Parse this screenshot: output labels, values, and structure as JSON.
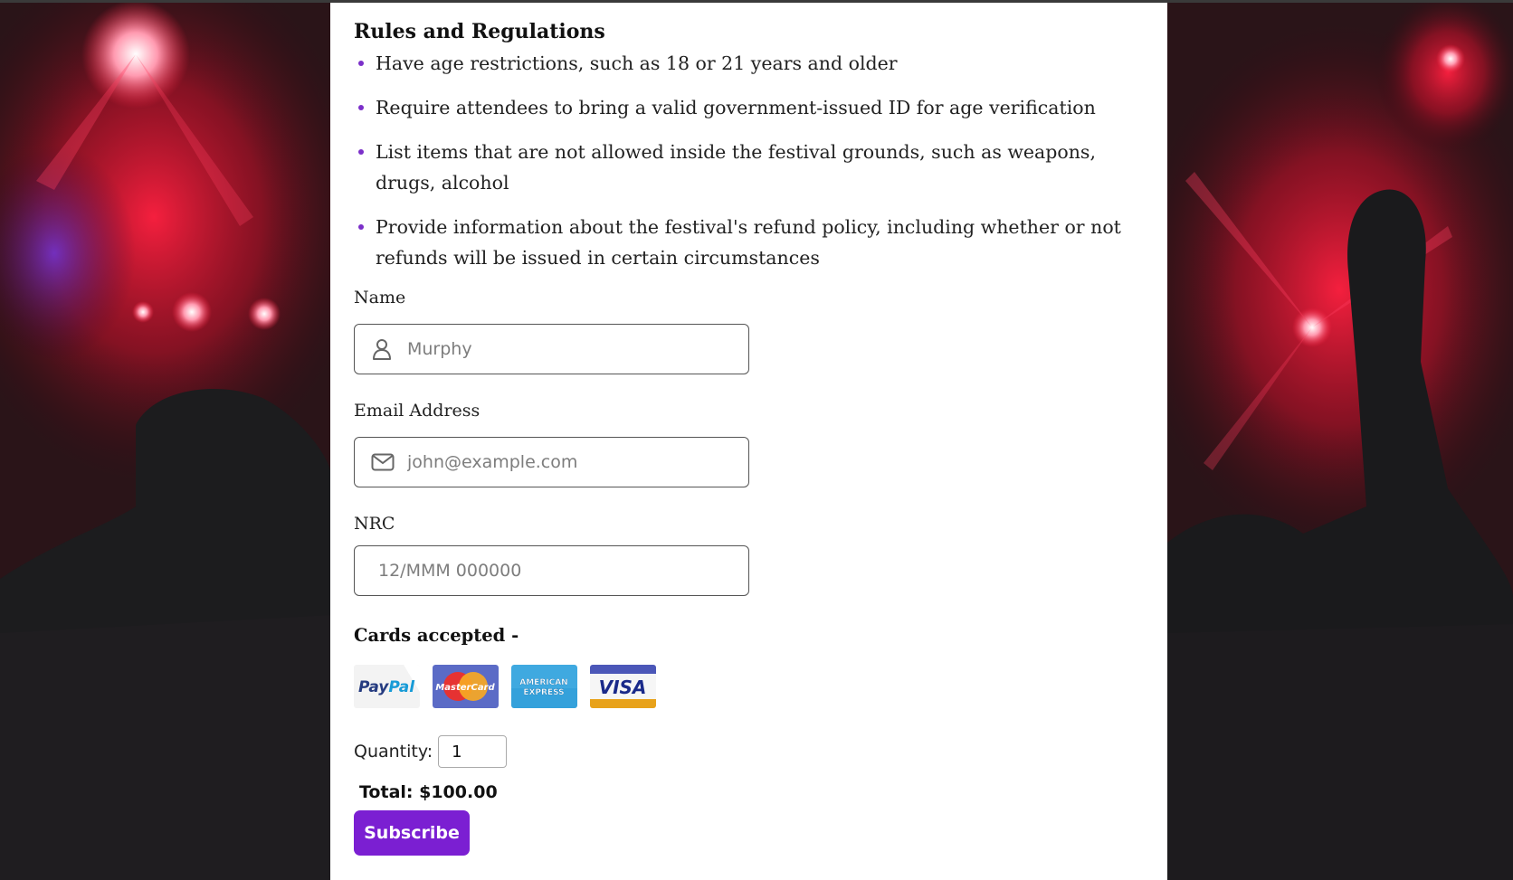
{
  "page": {
    "rules_title": "Rules and Regulations",
    "rules": [
      "Have age restrictions, such as 18 or 21 years and older",
      "Require attendees to bring a valid government-issued ID for age verification",
      "List items that are not allowed inside the festival grounds, such as weapons, drugs, alcohol",
      "Provide information about the festival's refund policy, including whether or not refunds will be issued in certain circumstances"
    ]
  },
  "form": {
    "name_label": "Name",
    "name_placeholder": "Murphy",
    "email_label": "Email Address",
    "email_placeholder": "john@example.com",
    "nrc_label": "NRC",
    "nrc_placeholder": "12/MMM 000000",
    "cards_title": "Cards accepted -",
    "cards": [
      "PayPal",
      "MasterCard",
      "AMERICAN EXPRESS",
      "VISA"
    ],
    "quantity_label": "Quantity:",
    "quantity_value": "1",
    "total": "Total: $100.00",
    "subscribe_label": "Subscribe"
  },
  "colors": {
    "accent": "#7b1fd2",
    "bullet": "#7b2fc9",
    "background_glow": "#ff1030"
  },
  "icons": [
    "user-icon",
    "mail-icon"
  ]
}
